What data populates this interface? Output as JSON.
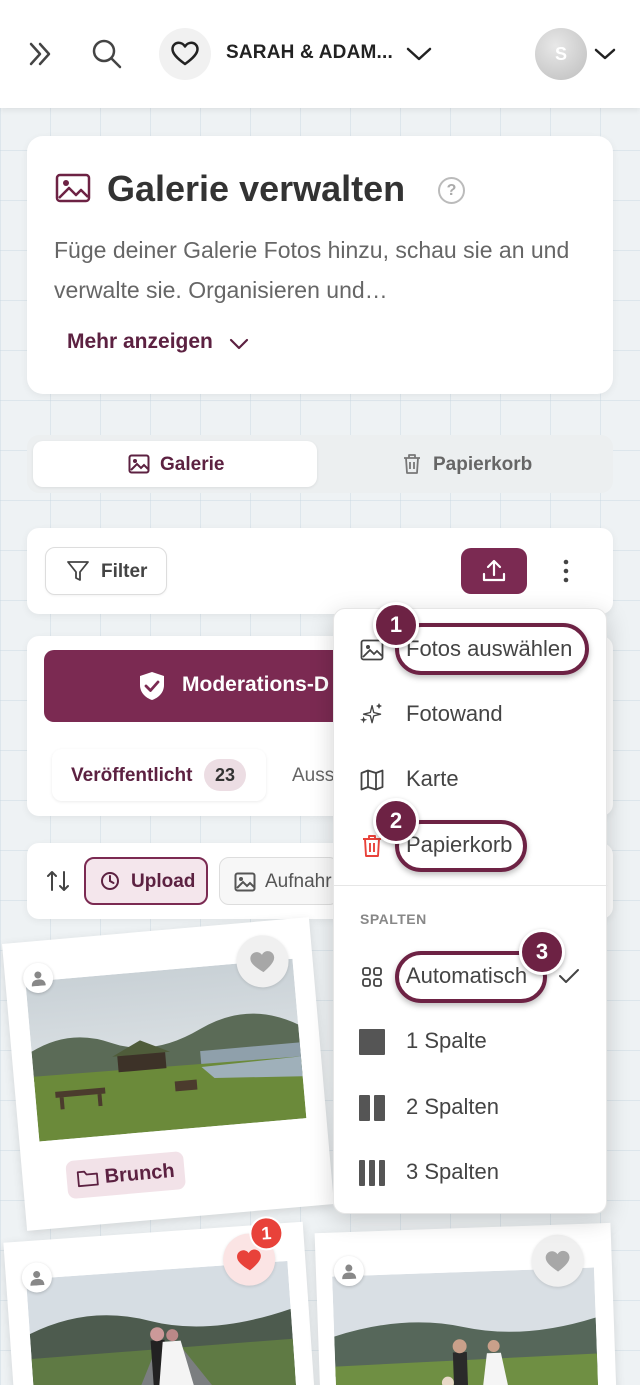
{
  "header": {
    "event_name": "SARAH & ADAM...",
    "avatar_initial": "S"
  },
  "gallery_card": {
    "title": "Galerie verwalten",
    "help": "?",
    "description": "Füge deiner Galerie Fotos hinzu, schau sie an und verwalte sie. Organisieren und…",
    "more_label": "Mehr anzeigen"
  },
  "tabs": [
    {
      "label": "Galerie",
      "active": true
    },
    {
      "label": "Papierkorb",
      "active": false
    }
  ],
  "toolbar": {
    "filter_label": "Filter"
  },
  "moderation": {
    "button_label": "Moderations-D",
    "published_label": "Veröffentlicht",
    "published_count": "23",
    "other_tab_label": "Auss"
  },
  "sort": {
    "upload_label": "Upload",
    "capture_label": "Aufnahr"
  },
  "photos": [
    {
      "tag": "Brunch"
    },
    {
      "notification_count": "1"
    },
    {}
  ],
  "menu": {
    "items": [
      {
        "label": "Fotos auswählen",
        "icon": "image-icon",
        "step": "1"
      },
      {
        "label": "Fotowand",
        "icon": "sparkles-icon"
      },
      {
        "label": "Karte",
        "icon": "map-icon"
      },
      {
        "label": "Papierkorb",
        "icon": "trash-icon",
        "step": "2"
      }
    ],
    "section_title": "SPALTEN",
    "columns": [
      {
        "label": "Automatisch",
        "icon": "grid-icon",
        "step": "3",
        "selected": true
      },
      {
        "label": "1 Spalte",
        "icon": "one-column-icon"
      },
      {
        "label": "2 Spalten",
        "icon": "two-columns-icon"
      },
      {
        "label": "3 Spalten",
        "icon": "three-columns-icon"
      }
    ]
  },
  "colors": {
    "accent": "#7b2a52",
    "danger": "#e8423a"
  }
}
